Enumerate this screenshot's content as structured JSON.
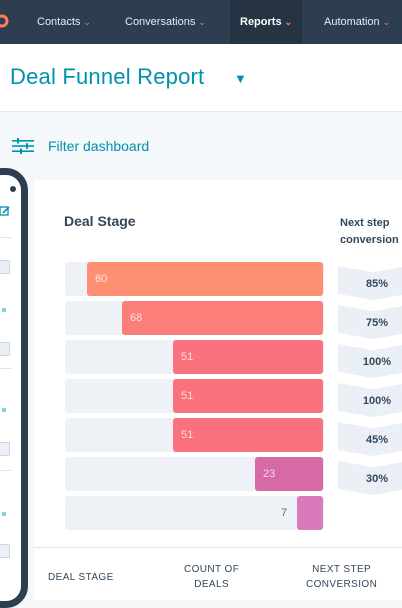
{
  "nav": {
    "items": [
      {
        "label": "Contacts"
      },
      {
        "label": "Conversations"
      },
      {
        "label": "Reports"
      },
      {
        "label": "Automation"
      }
    ]
  },
  "header": {
    "title": "Deal Funnel Report"
  },
  "filter": {
    "label": "Filter dashboard"
  },
  "report": {
    "deal_stage_label": "Deal Stage",
    "next_step_line1": "Next step",
    "next_step_line2": "conversion",
    "bars": [
      {
        "value": "80",
        "color": "#ff8f73"
      },
      {
        "value": "68",
        "color": "#fb7f78"
      },
      {
        "value": "51",
        "color": "#f9727e"
      },
      {
        "value": "51",
        "color": "#f9727e"
      },
      {
        "value": "51",
        "color": "#f9727e"
      },
      {
        "value": "23",
        "color": "#d669a6"
      },
      {
        "value": "7",
        "color": "#d97bbb"
      }
    ],
    "conversions": [
      "85%",
      "75%",
      "100%",
      "100%",
      "45%",
      "30%"
    ]
  },
  "table": {
    "deal_stage": "DEAL STAGE",
    "count_line1": "COUNT OF",
    "count_line2": "DEALS",
    "next_line1": "NEXT STEP",
    "next_line2": "CONVERSION"
  },
  "icons": {
    "logo": "hubspot-sprocket-icon",
    "filter": "sliders-icon",
    "edit": "edit-icon"
  }
}
